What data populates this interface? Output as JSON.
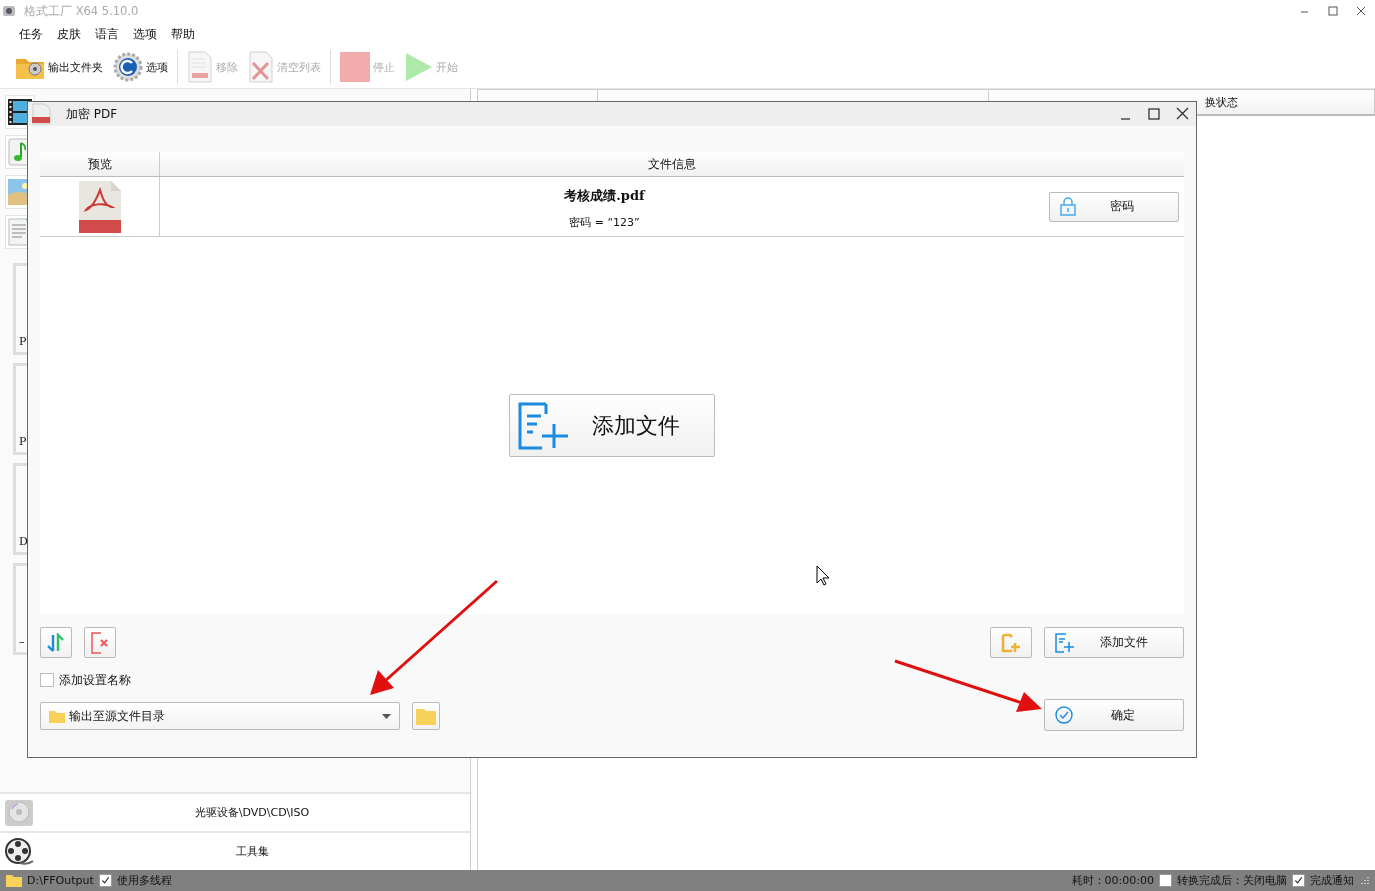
{
  "window": {
    "title": "格式工厂 X64 5.10.0"
  },
  "menu": [
    "任务",
    "皮肤",
    "语言",
    "选项",
    "帮助"
  ],
  "toolbar": [
    {
      "label": "输出文件夹",
      "kind": "folder",
      "disabled": false
    },
    {
      "label": "选项",
      "kind": "gear",
      "disabled": false
    },
    {
      "label": "移除",
      "kind": "remove",
      "disabled": true
    },
    {
      "label": "清空列表",
      "kind": "clear",
      "disabled": true
    },
    {
      "label": "停止",
      "kind": "stop",
      "disabled": true
    },
    {
      "label": "开始",
      "kind": "start",
      "disabled": true
    }
  ],
  "sidebar": {
    "categories": [
      {
        "kind": "video"
      },
      {
        "kind": "audio"
      },
      {
        "kind": "image"
      },
      {
        "kind": "document"
      }
    ],
    "cards": [
      "P",
      "P",
      "D",
      "–"
    ],
    "bottom_items": [
      {
        "label": "光驱设备\\DVD\\CD\\ISO",
        "kind": "disc"
      },
      {
        "label": "工具集",
        "kind": "reel"
      }
    ]
  },
  "task_table": {
    "columns": [
      "换状态"
    ]
  },
  "dialog": {
    "title": "加密 PDF",
    "columns": [
      "预览",
      "文件信息"
    ],
    "files": [
      {
        "name": "考核成绩.pdf",
        "password": "密码 = “123”",
        "button": "密码"
      }
    ],
    "add_file_big": "添加文件",
    "add_file": "添加文件",
    "add_settings_name": {
      "label": "添加设置名称",
      "checked": false
    },
    "output": {
      "value": "输出至源文件目录"
    },
    "confirm": "确定"
  },
  "status_bar": {
    "output_path": "D:\\FFOutput",
    "multithread": {
      "label": "使用多线程",
      "checked": true
    },
    "elapsed": "耗时：00:00:00",
    "shutdown": {
      "label": "转换完成后：关闭电脑",
      "checked": false
    },
    "notify": {
      "label": "完成通知",
      "checked": true
    }
  }
}
